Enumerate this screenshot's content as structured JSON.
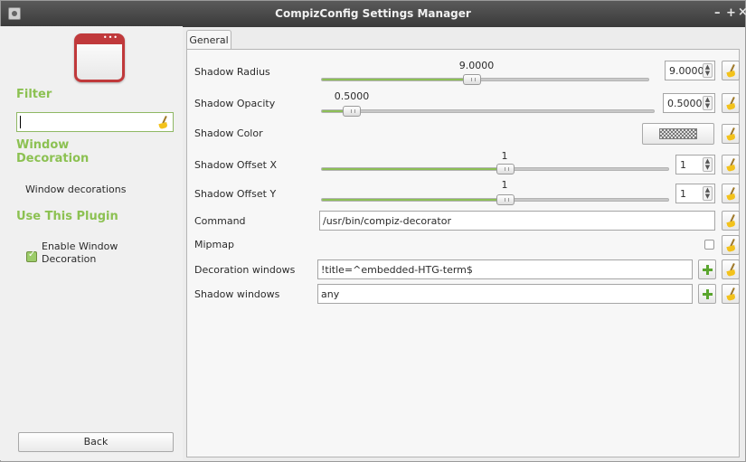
{
  "window": {
    "title": "CompizConfig Settings Manager",
    "controls": [
      "–",
      "+",
      "×"
    ]
  },
  "sidebar": {
    "filter_heading": "Filter",
    "filter_value": "",
    "section_heading": "Window Decoration",
    "description": "Window decorations",
    "use_heading": "Use This Plugin",
    "enable_label": "Enable Window Decoration",
    "enable_checked": true,
    "back_label": "Back"
  },
  "tabs": [
    "General"
  ],
  "settings": {
    "shadow_radius": {
      "label": "Shadow Radius",
      "value": "9.0000",
      "spin": "9.0000",
      "fraction": 0.46
    },
    "shadow_opacity": {
      "label": "Shadow Opacity",
      "value": "0.5000",
      "spin": "0.5000",
      "fraction": 0.09
    },
    "shadow_color": {
      "label": "Shadow Color"
    },
    "shadow_offset_x": {
      "label": "Shadow Offset X",
      "value": "1",
      "spin": "1",
      "fraction": 0.53
    },
    "shadow_offset_y": {
      "label": "Shadow Offset Y",
      "value": "1",
      "spin": "1",
      "fraction": 0.53
    },
    "command": {
      "label": "Command",
      "value": "/usr/bin/compiz-decorator"
    },
    "mipmap": {
      "label": "Mipmap",
      "checked": false
    },
    "decoration_windows": {
      "label": "Decoration windows",
      "value": "!title=^embedded-HTG-term$"
    },
    "shadow_windows": {
      "label": "Shadow windows",
      "value": "any"
    }
  },
  "icons": [
    "app-icon",
    "window-decoration-plugin-icon",
    "broom-icon",
    "plus-icon",
    "checkerboard-swatch"
  ]
}
